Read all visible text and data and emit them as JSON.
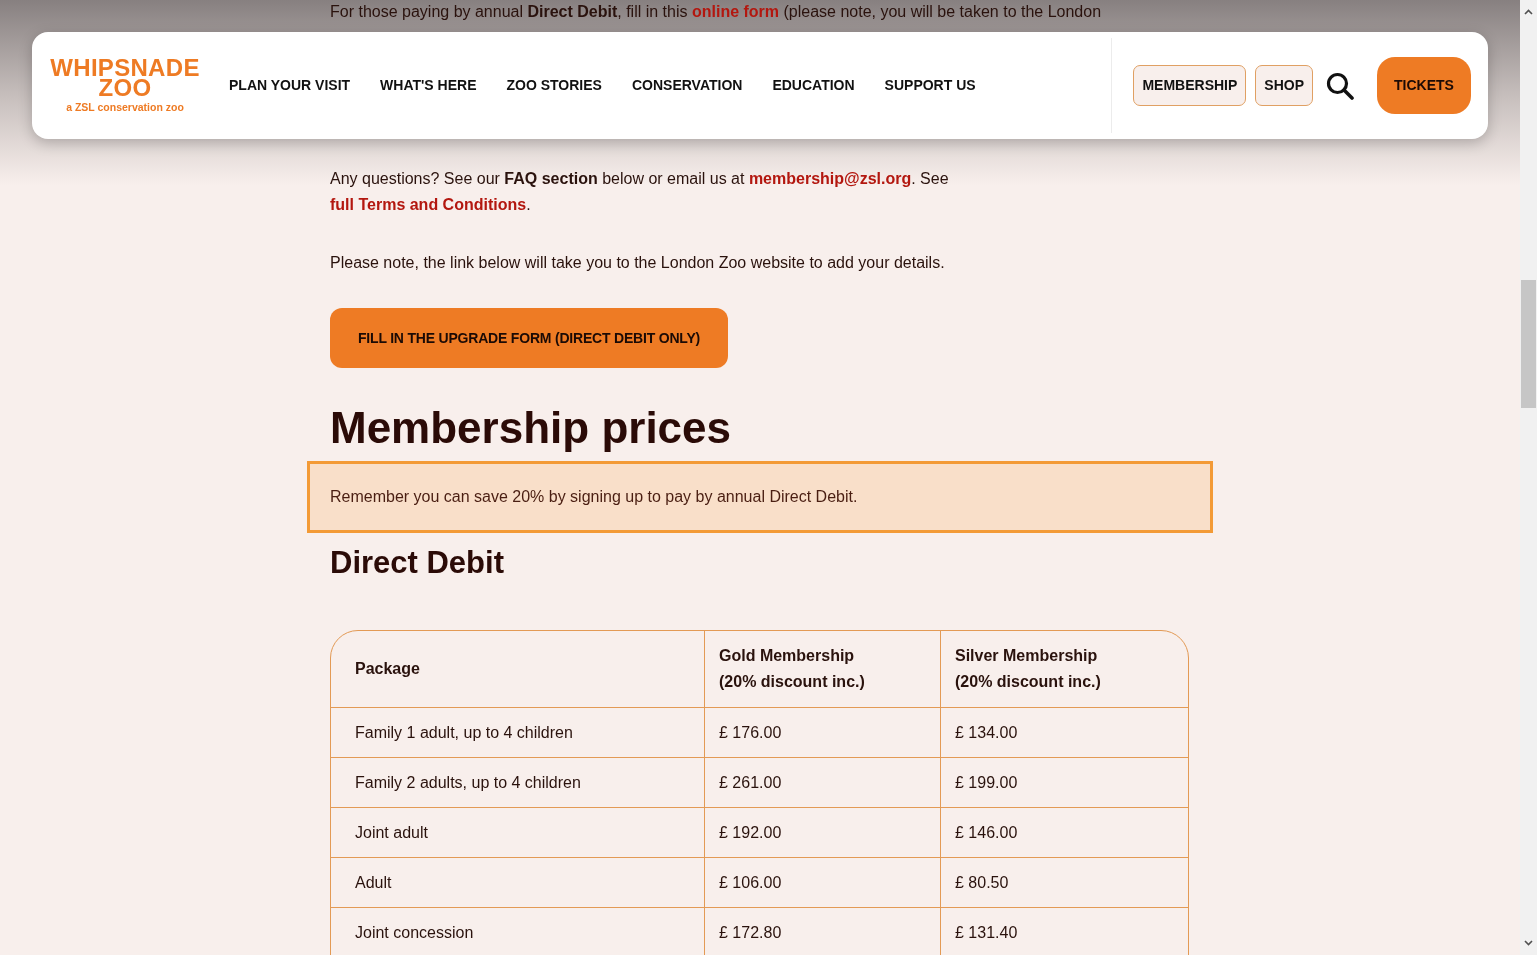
{
  "intro": [
    {
      "kind": "text",
      "text": "For those paying by annual **Direct Debit**, fill in this "
    },
    {
      "kind": "link",
      "text": "online form"
    },
    {
      "kind": "text",
      "text": " (please note, you will be taken to the London"
    }
  ],
  "header": {
    "logo": {
      "name": "WHIPSNADE",
      "line2": "ZOO",
      "tagline": "a ZSL conservation zoo"
    },
    "nav": [
      "PLAN YOUR VISIT",
      "WHAT'S HERE",
      "ZOO STORIES",
      "CONSERVATION",
      "EDUCATION",
      "SUPPORT US"
    ],
    "actions": [
      {
        "kind": "outline",
        "label": "MEMBERSHIP"
      },
      {
        "kind": "outline",
        "label": "SHOP"
      },
      {
        "kind": "search"
      },
      {
        "kind": "primary",
        "label": "TICKETS"
      }
    ]
  },
  "questions": [
    {
      "kind": "text",
      "text": "Any questions? See our **FAQ section** below or email us at "
    },
    {
      "kind": "link",
      "text": "membership@zsl.org"
    },
    {
      "kind": "text",
      "text": ". See "
    },
    {
      "kind": "link",
      "text": "full Terms and Conditions"
    },
    {
      "kind": "text",
      "text": "."
    }
  ],
  "note": "Please note, the link below will take you to the London Zoo website to add your details.",
  "cta_button": "FILL IN THE UPGRADE FORM (DIRECT DEBIT ONLY)",
  "heading": "Membership prices",
  "callout": "Remember you can save 20% by signing up to pay by annual Direct Debit.",
  "subheading": "Direct Debit",
  "table": {
    "columns": [
      "Package",
      "Gold Membership\n(20% discount inc.)",
      "Silver Membership\n(20% discount inc.)"
    ],
    "rows": [
      [
        "Family 1 adult, up to 4 children",
        "£ 176.00",
        "£ 134.00"
      ],
      [
        "Family 2 adults, up to 4 children",
        "£ 261.00",
        "£ 199.00"
      ],
      [
        "Joint adult",
        "£ 192.00",
        "£ 146.00"
      ],
      [
        "Adult",
        "£ 106.00",
        "£ 80.50"
      ],
      [
        "Joint concession",
        "£ 172.80",
        "£ 131.40"
      ]
    ]
  }
}
